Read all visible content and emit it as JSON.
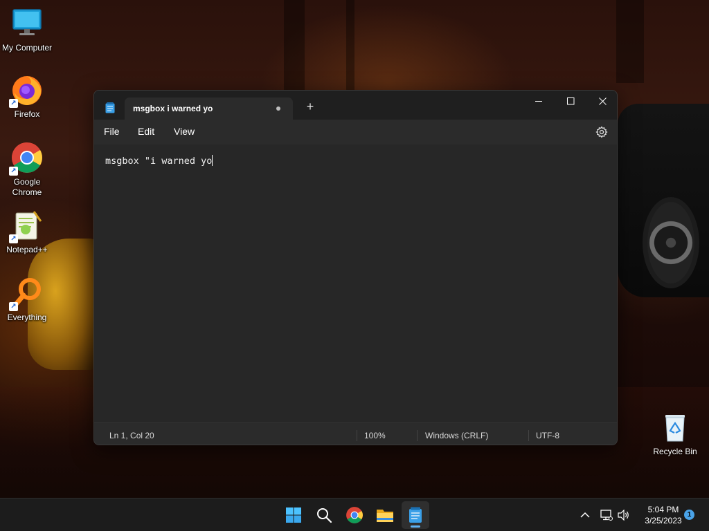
{
  "desktop": {
    "icons": [
      {
        "label": "My Computer",
        "icon": "monitor-icon"
      },
      {
        "label": "Firefox",
        "icon": "firefox-icon"
      },
      {
        "label": "Google\nChrome",
        "icon": "chrome-icon"
      },
      {
        "label": "Notepad++",
        "icon": "notepadpp-icon"
      },
      {
        "label": "Everything",
        "icon": "everything-search-icon"
      }
    ],
    "recycle_bin": {
      "label": "Recycle Bin",
      "icon": "recycle-bin-icon"
    }
  },
  "notepad": {
    "tab_title": "msgbox i warned yo",
    "tab_unsaved": true,
    "menu": [
      "File",
      "Edit",
      "View"
    ],
    "content": "msgbox \"i warned yo",
    "status": {
      "position": "Ln 1, Col 20",
      "zoom": "100%",
      "line_ending": "Windows (CRLF)",
      "encoding": "UTF-8"
    }
  },
  "taskbar": {
    "apps": [
      "start-icon",
      "search-icon",
      "chrome-icon",
      "file-explorer-icon",
      "notepad-icon"
    ],
    "active_app": "notepad-icon",
    "clock": {
      "time": "5:04 PM",
      "date": "3/25/2023"
    },
    "notification_count": "1",
    "tray": [
      "chevron-up-icon",
      "network-icon",
      "volume-icon"
    ]
  },
  "colors": {
    "window_bg": "#272727",
    "titlebar_bg": "#1f1f1f",
    "taskbar_bg": "#1c1c1c",
    "accent": "#5fb2f2"
  }
}
